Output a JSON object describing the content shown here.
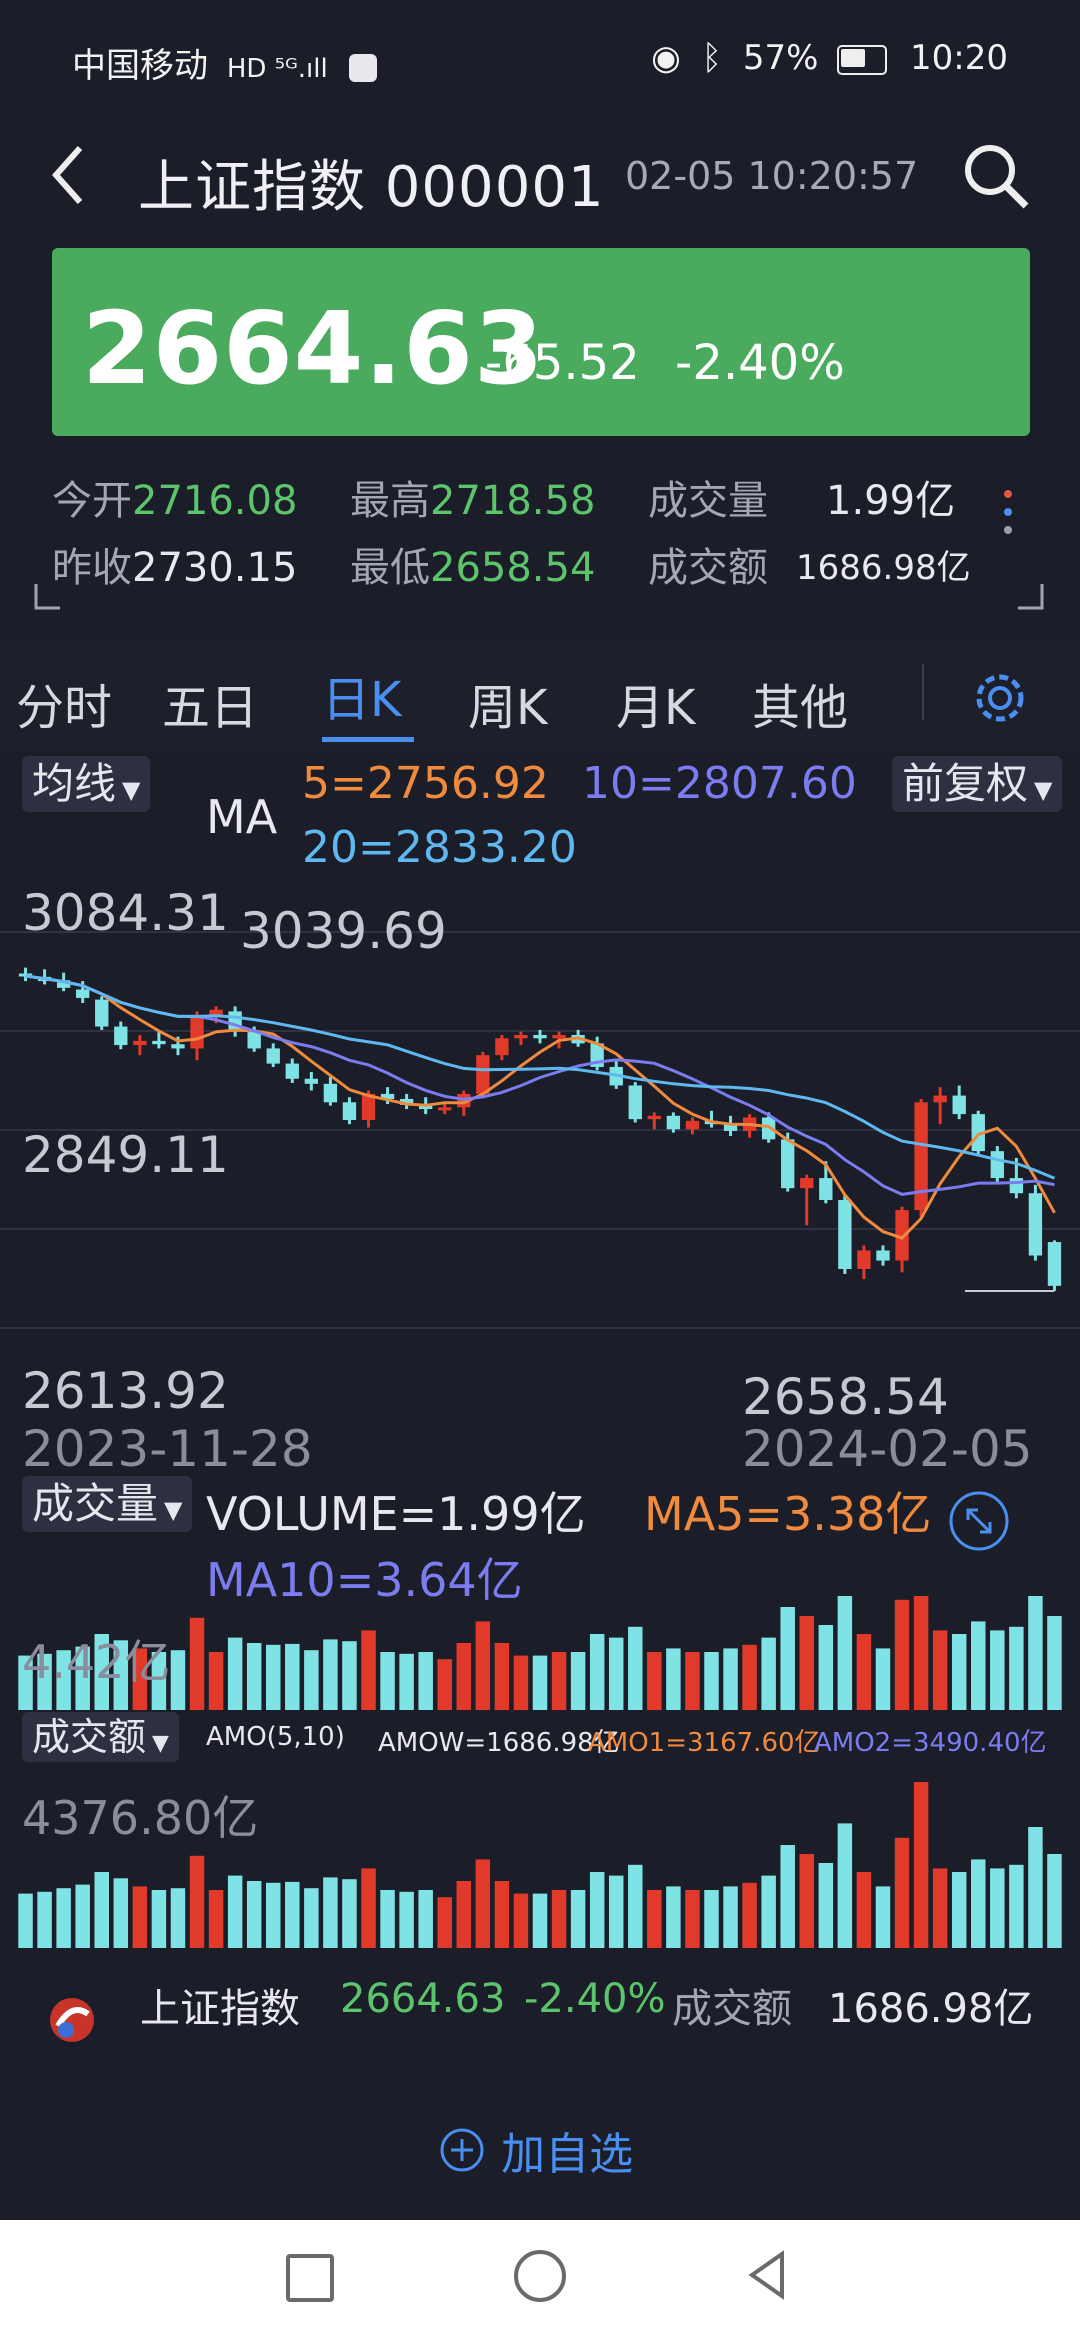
{
  "status_bar": {
    "carrier": "中国移动",
    "network_badges": "HD ⁵ᴳ.ıll",
    "battery": "57%",
    "time": "10:20"
  },
  "header": {
    "title": "上证指数 000001",
    "timestamp": "02-05 10:20:57"
  },
  "quote": {
    "price": "2664.63",
    "change": "-65.52",
    "change_pct": "-2.40%",
    "open_label": "今开",
    "open": "2716.08",
    "high_label": "最高",
    "high": "2718.58",
    "volume_label": "成交量",
    "volume": "1.99亿",
    "prev_close_label": "昨收",
    "prev_close": "2730.15",
    "low_label": "最低",
    "low": "2658.54",
    "amount_label": "成交额",
    "amount": "1686.98亿"
  },
  "tabs": [
    "分时",
    "五日",
    "日K",
    "周K",
    "月K",
    "其他"
  ],
  "active_tab": "日K",
  "kline": {
    "indicator_select": "均线",
    "adjust_select": "前复权",
    "ma_label": "MA",
    "ma5": "5=2756.92",
    "ma10": "10=2807.60",
    "ma20": "20=2833.20",
    "y_top": "3084.31",
    "y_mid": "2849.11",
    "y_bottom": "2613.92",
    "max_label": "3039.69",
    "min_label": "2658.54",
    "date_start": "2023-11-28",
    "date_end": "2024-02-05",
    "colors": {
      "ma5": "#f08a3c",
      "ma10": "#7a7cf0",
      "ma20": "#5fb8ef",
      "up": "#e23a2a",
      "down": "#7fe3e6"
    }
  },
  "volume_panel": {
    "select": "成交量",
    "volume": "VOLUME=1.99亿",
    "ma5": "MA5=3.38亿",
    "ma10": "MA10=3.64亿",
    "y_top": "4.42亿"
  },
  "amount_panel": {
    "select": "成交额",
    "amo": "AMO(5,10)",
    "amow": "AMOW=1686.98亿",
    "amo1": "AMO1=3167.60亿",
    "amo2": "AMO2=3490.40亿",
    "y_top": "4376.80亿"
  },
  "footer": {
    "name": "上证指数",
    "price": "2664.63",
    "pct": "-2.40%",
    "amount_label": "成交额",
    "amount": "1686.98亿",
    "add_watch": "加自选"
  },
  "chart_data": {
    "type": "candlestick",
    "x_range": [
      "2023-11-28",
      "2024-02-05"
    ],
    "ylim": [
      2613.92,
      3084.31
    ],
    "y_ticks": [
      3084.31,
      2849.11,
      2613.92
    ],
    "series": [
      {
        "name": "5",
        "last": 2756.92
      },
      {
        "name": "10",
        "last": 2807.6
      },
      {
        "name": "20",
        "last": 2833.2
      }
    ],
    "candles": [
      [
        3035,
        3042,
        3026,
        3032
      ],
      [
        3031,
        3040,
        3022,
        3026
      ],
      [
        3027,
        3036,
        3014,
        3018
      ],
      [
        3016,
        3026,
        3000,
        3006
      ],
      [
        3004,
        3008,
        2968,
        2972
      ],
      [
        2972,
        2978,
        2945,
        2950
      ],
      [
        2950,
        2962,
        2938,
        2955
      ],
      [
        2955,
        2966,
        2946,
        2951
      ],
      [
        2951,
        2960,
        2938,
        2946
      ],
      [
        2946,
        2990,
        2932,
        2984
      ],
      [
        2984,
        2996,
        2976,
        2992
      ],
      [
        2990,
        2996,
        2960,
        2966
      ],
      [
        2966,
        2972,
        2942,
        2946
      ],
      [
        2946,
        2952,
        2924,
        2928
      ],
      [
        2928,
        2934,
        2905,
        2910
      ],
      [
        2910,
        2918,
        2896,
        2904
      ],
      [
        2904,
        2912,
        2878,
        2882
      ],
      [
        2882,
        2888,
        2856,
        2861
      ],
      [
        2861,
        2896,
        2852,
        2892
      ],
      [
        2892,
        2900,
        2880,
        2886
      ],
      [
        2886,
        2892,
        2874,
        2879
      ],
      [
        2879,
        2888,
        2868,
        2874
      ],
      [
        2874,
        2880,
        2868,
        2876
      ],
      [
        2876,
        2896,
        2866,
        2892
      ],
      [
        2892,
        2942,
        2888,
        2938
      ],
      [
        2938,
        2962,
        2932,
        2958
      ],
      [
        2958,
        2966,
        2950,
        2962
      ],
      [
        2962,
        2968,
        2952,
        2958
      ],
      [
        2958,
        2966,
        2946,
        2962
      ],
      [
        2962,
        2968,
        2948,
        2952
      ],
      [
        2952,
        2960,
        2920,
        2924
      ],
      [
        2924,
        2934,
        2898,
        2902
      ],
      [
        2902,
        2906,
        2858,
        2862
      ],
      [
        2862,
        2870,
        2850,
        2866
      ],
      [
        2866,
        2870,
        2846,
        2850
      ],
      [
        2850,
        2864,
        2844,
        2860
      ],
      [
        2860,
        2872,
        2852,
        2856
      ],
      [
        2856,
        2866,
        2842,
        2848
      ],
      [
        2848,
        2868,
        2840,
        2864
      ],
      [
        2864,
        2870,
        2834,
        2838
      ],
      [
        2838,
        2846,
        2776,
        2780
      ],
      [
        2780,
        2796,
        2736,
        2792
      ],
      [
        2792,
        2812,
        2762,
        2766
      ],
      [
        2766,
        2772,
        2678,
        2684
      ],
      [
        2684,
        2712,
        2672,
        2706
      ],
      [
        2706,
        2712,
        2688,
        2694
      ],
      [
        2694,
        2758,
        2680,
        2754
      ],
      [
        2754,
        2886,
        2746,
        2882
      ],
      [
        2882,
        2900,
        2856,
        2890
      ],
      [
        2890,
        2902,
        2862,
        2868
      ],
      [
        2868,
        2872,
        2818,
        2824
      ],
      [
        2824,
        2830,
        2786,
        2792
      ],
      [
        2792,
        2816,
        2768,
        2774
      ],
      [
        2774,
        2784,
        2694,
        2700
      ],
      [
        2716,
        2718,
        2658,
        2664
      ]
    ]
  }
}
